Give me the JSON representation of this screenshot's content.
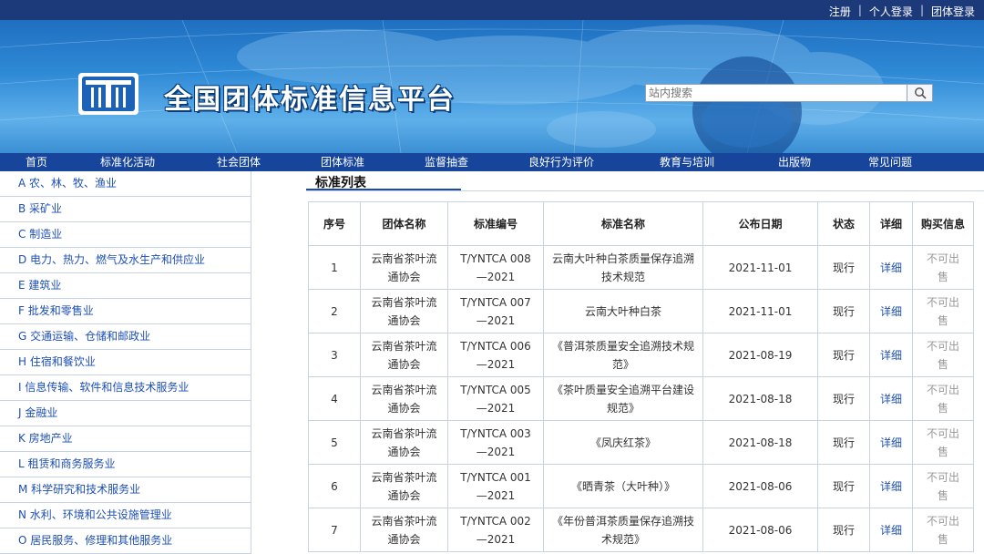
{
  "topbar": {
    "register": "注册",
    "personal_login": "个人登录",
    "group_login": "团体登录",
    "sep": "|"
  },
  "header": {
    "site_title": "全国团体标准信息平台",
    "search_placeholder": "站内搜索"
  },
  "nav": [
    {
      "label": "首页"
    },
    {
      "label": "标准化活动"
    },
    {
      "label": "社会团体"
    },
    {
      "label": "团体标准"
    },
    {
      "label": "监督抽查"
    },
    {
      "label": "良好行为评价"
    },
    {
      "label": "教育与培训"
    },
    {
      "label": "出版物"
    },
    {
      "label": "常见问题"
    }
  ],
  "sidebar": {
    "items": [
      {
        "label": "A 农、林、牧、渔业"
      },
      {
        "label": "B 采矿业"
      },
      {
        "label": "C 制造业"
      },
      {
        "label": "D 电力、热力、燃气及水生产和供应业"
      },
      {
        "label": "E 建筑业"
      },
      {
        "label": "F 批发和零售业"
      },
      {
        "label": "G 交通运输、仓储和邮政业"
      },
      {
        "label": "H 住宿和餐饮业"
      },
      {
        "label": "I 信息传输、软件和信息技术服务业"
      },
      {
        "label": "J 金融业"
      },
      {
        "label": "K 房地产业"
      },
      {
        "label": "L 租赁和商务服务业"
      },
      {
        "label": "M 科学研究和技术服务业"
      },
      {
        "label": "N 水利、环境和公共设施管理业"
      },
      {
        "label": "O 居民服务、修理和其他服务业"
      }
    ]
  },
  "main": {
    "section_title": "标准列表",
    "columns": [
      "序号",
      "团体名称",
      "标准编号",
      "标准名称",
      "公布日期",
      "状态",
      "详细",
      "购买信息"
    ],
    "rows": [
      {
        "no": "1",
        "org": "云南省茶叶流通协会",
        "code": "T/YNTCA 008—2021",
        "name": "云南大叶种白茶质量保存追溯技术规范",
        "date": "2021-11-01",
        "status": "现行",
        "detail": "详细",
        "buy": "不可出售"
      },
      {
        "no": "2",
        "org": "云南省茶叶流通协会",
        "code": "T/YNTCA 007—2021",
        "name": "云南大叶种白茶",
        "date": "2021-11-01",
        "status": "现行",
        "detail": "详细",
        "buy": "不可出售"
      },
      {
        "no": "3",
        "org": "云南省茶叶流通协会",
        "code": "T/YNTCA 006—2021",
        "name": "《普洱茶质量安全追溯技术规范》",
        "date": "2021-08-19",
        "status": "现行",
        "detail": "详细",
        "buy": "不可出售"
      },
      {
        "no": "4",
        "org": "云南省茶叶流通协会",
        "code": "T/YNTCA 005—2021",
        "name": "《茶叶质量安全追溯平台建设规范》",
        "date": "2021-08-18",
        "status": "现行",
        "detail": "详细",
        "buy": "不可出售"
      },
      {
        "no": "5",
        "org": "云南省茶叶流通协会",
        "code": "T/YNTCA 003—2021",
        "name": "《凤庆红茶》",
        "date": "2021-08-18",
        "status": "现行",
        "detail": "详细",
        "buy": "不可出售"
      },
      {
        "no": "6",
        "org": "云南省茶叶流通协会",
        "code": "T/YNTCA 001—2021",
        "name": "《晒青茶（大叶种）》",
        "date": "2021-08-06",
        "status": "现行",
        "detail": "详细",
        "buy": "不可出售"
      },
      {
        "no": "7",
        "org": "云南省茶叶流通协会",
        "code": "T/YNTCA 002—2021",
        "name": "《年份普洱茶质量保存追溯技术规范》",
        "date": "2021-08-06",
        "status": "现行",
        "detail": "详细",
        "buy": "不可出售"
      }
    ]
  },
  "colors": {
    "topbar_bg": "#1c3a7a",
    "nav_bg": "#16459b",
    "link": "#1e4fb4",
    "border": "#c9d3e6"
  }
}
